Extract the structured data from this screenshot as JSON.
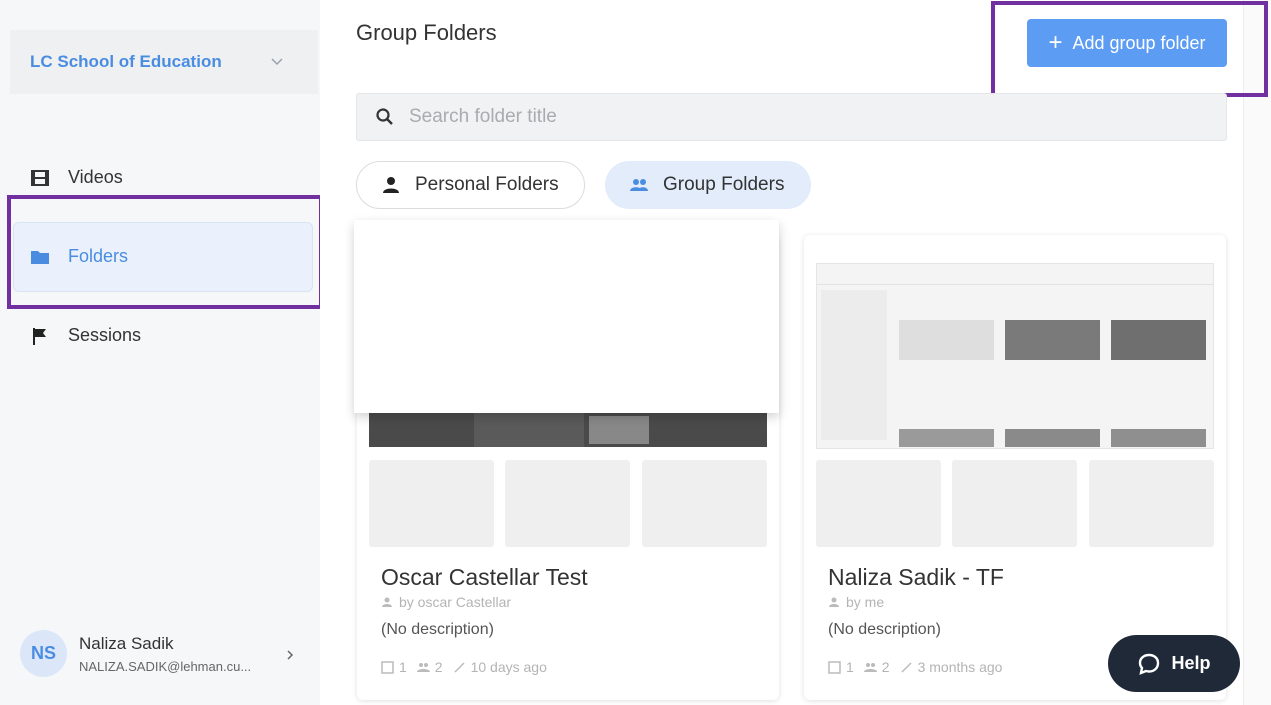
{
  "sidebar": {
    "org_name": "LC School of Education",
    "nav": [
      {
        "label": "Videos",
        "icon": "film-icon"
      },
      {
        "label": "Folders",
        "icon": "folder-icon",
        "active": true
      },
      {
        "label": "Sessions",
        "icon": "flag-icon"
      }
    ],
    "user": {
      "initials": "NS",
      "name": "Naliza Sadik",
      "email": "NALIZA.SADIK@lehman.cu..."
    }
  },
  "header": {
    "title": "Group Folders",
    "add_button": "Add group folder"
  },
  "search": {
    "placeholder": "Search folder title"
  },
  "filters": {
    "personal": "Personal Folders",
    "group": "Group Folders",
    "active": "group"
  },
  "cards": [
    {
      "title": "Oscar Castellar Test",
      "owner": "by oscar Castellar",
      "description": "(No description)",
      "videos": "1",
      "members": "2",
      "updated": "10 days ago"
    },
    {
      "title": "Naliza Sadik - TF",
      "owner": "by me",
      "description": "(No description)",
      "videos": "1",
      "members": "2",
      "updated": "3 months ago"
    }
  ],
  "help": {
    "label": "Help"
  },
  "colors": {
    "accent": "#5c9cf2",
    "highlight": "#7030a0",
    "help_bg": "#1f2937"
  }
}
